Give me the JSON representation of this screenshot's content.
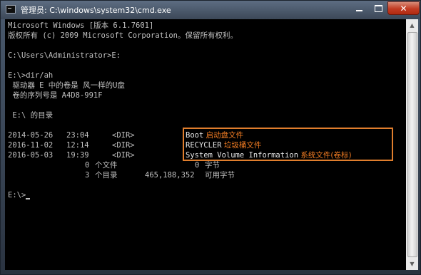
{
  "window": {
    "title": "管理员: C:\\windows\\system32\\cmd.exe",
    "buttons": {
      "minimize": "—",
      "maximize": "□",
      "close": "✕"
    }
  },
  "console": {
    "lines": [
      "Microsoft Windows [版本 6.1.7601]",
      "版权所有 (c) 2009 Microsoft Corporation。保留所有权利。",
      "",
      "C:\\Users\\Administrator>E:",
      "",
      "E:\\>dir/ah",
      " 驱动器 E 中的卷是 风一样的U盘",
      " 卷的序列号是 A4D8-991F",
      "",
      " E:\\ 的目录",
      ""
    ],
    "dir_entries": [
      {
        "date": "2014-05-26",
        "time": "23:04",
        "type": "<DIR>",
        "name": "Boot",
        "note": "启动盘文件"
      },
      {
        "date": "2016-11-02",
        "time": "12:14",
        "type": "<DIR>",
        "name": "RECYCLER",
        "note": "垃圾桶文件"
      },
      {
        "date": "2016-05-03",
        "time": "19:39",
        "type": "<DIR>",
        "name": "System Volume Information",
        "note": "系统文件(卷标)"
      }
    ],
    "summary": [
      {
        "count": "0",
        "label": "个文件",
        "size": "0",
        "unit": "字节"
      },
      {
        "count": "3",
        "label": "个目录",
        "size": "465,188,352",
        "unit": "可用字节"
      }
    ],
    "prompt": "E:\\>"
  },
  "colors": {
    "console_bg": "#000000",
    "console_text": "#c0c0c0",
    "annotation_border": "#e07e2d",
    "annotation_text": "#f07b22",
    "close_button": "#c23b22"
  }
}
